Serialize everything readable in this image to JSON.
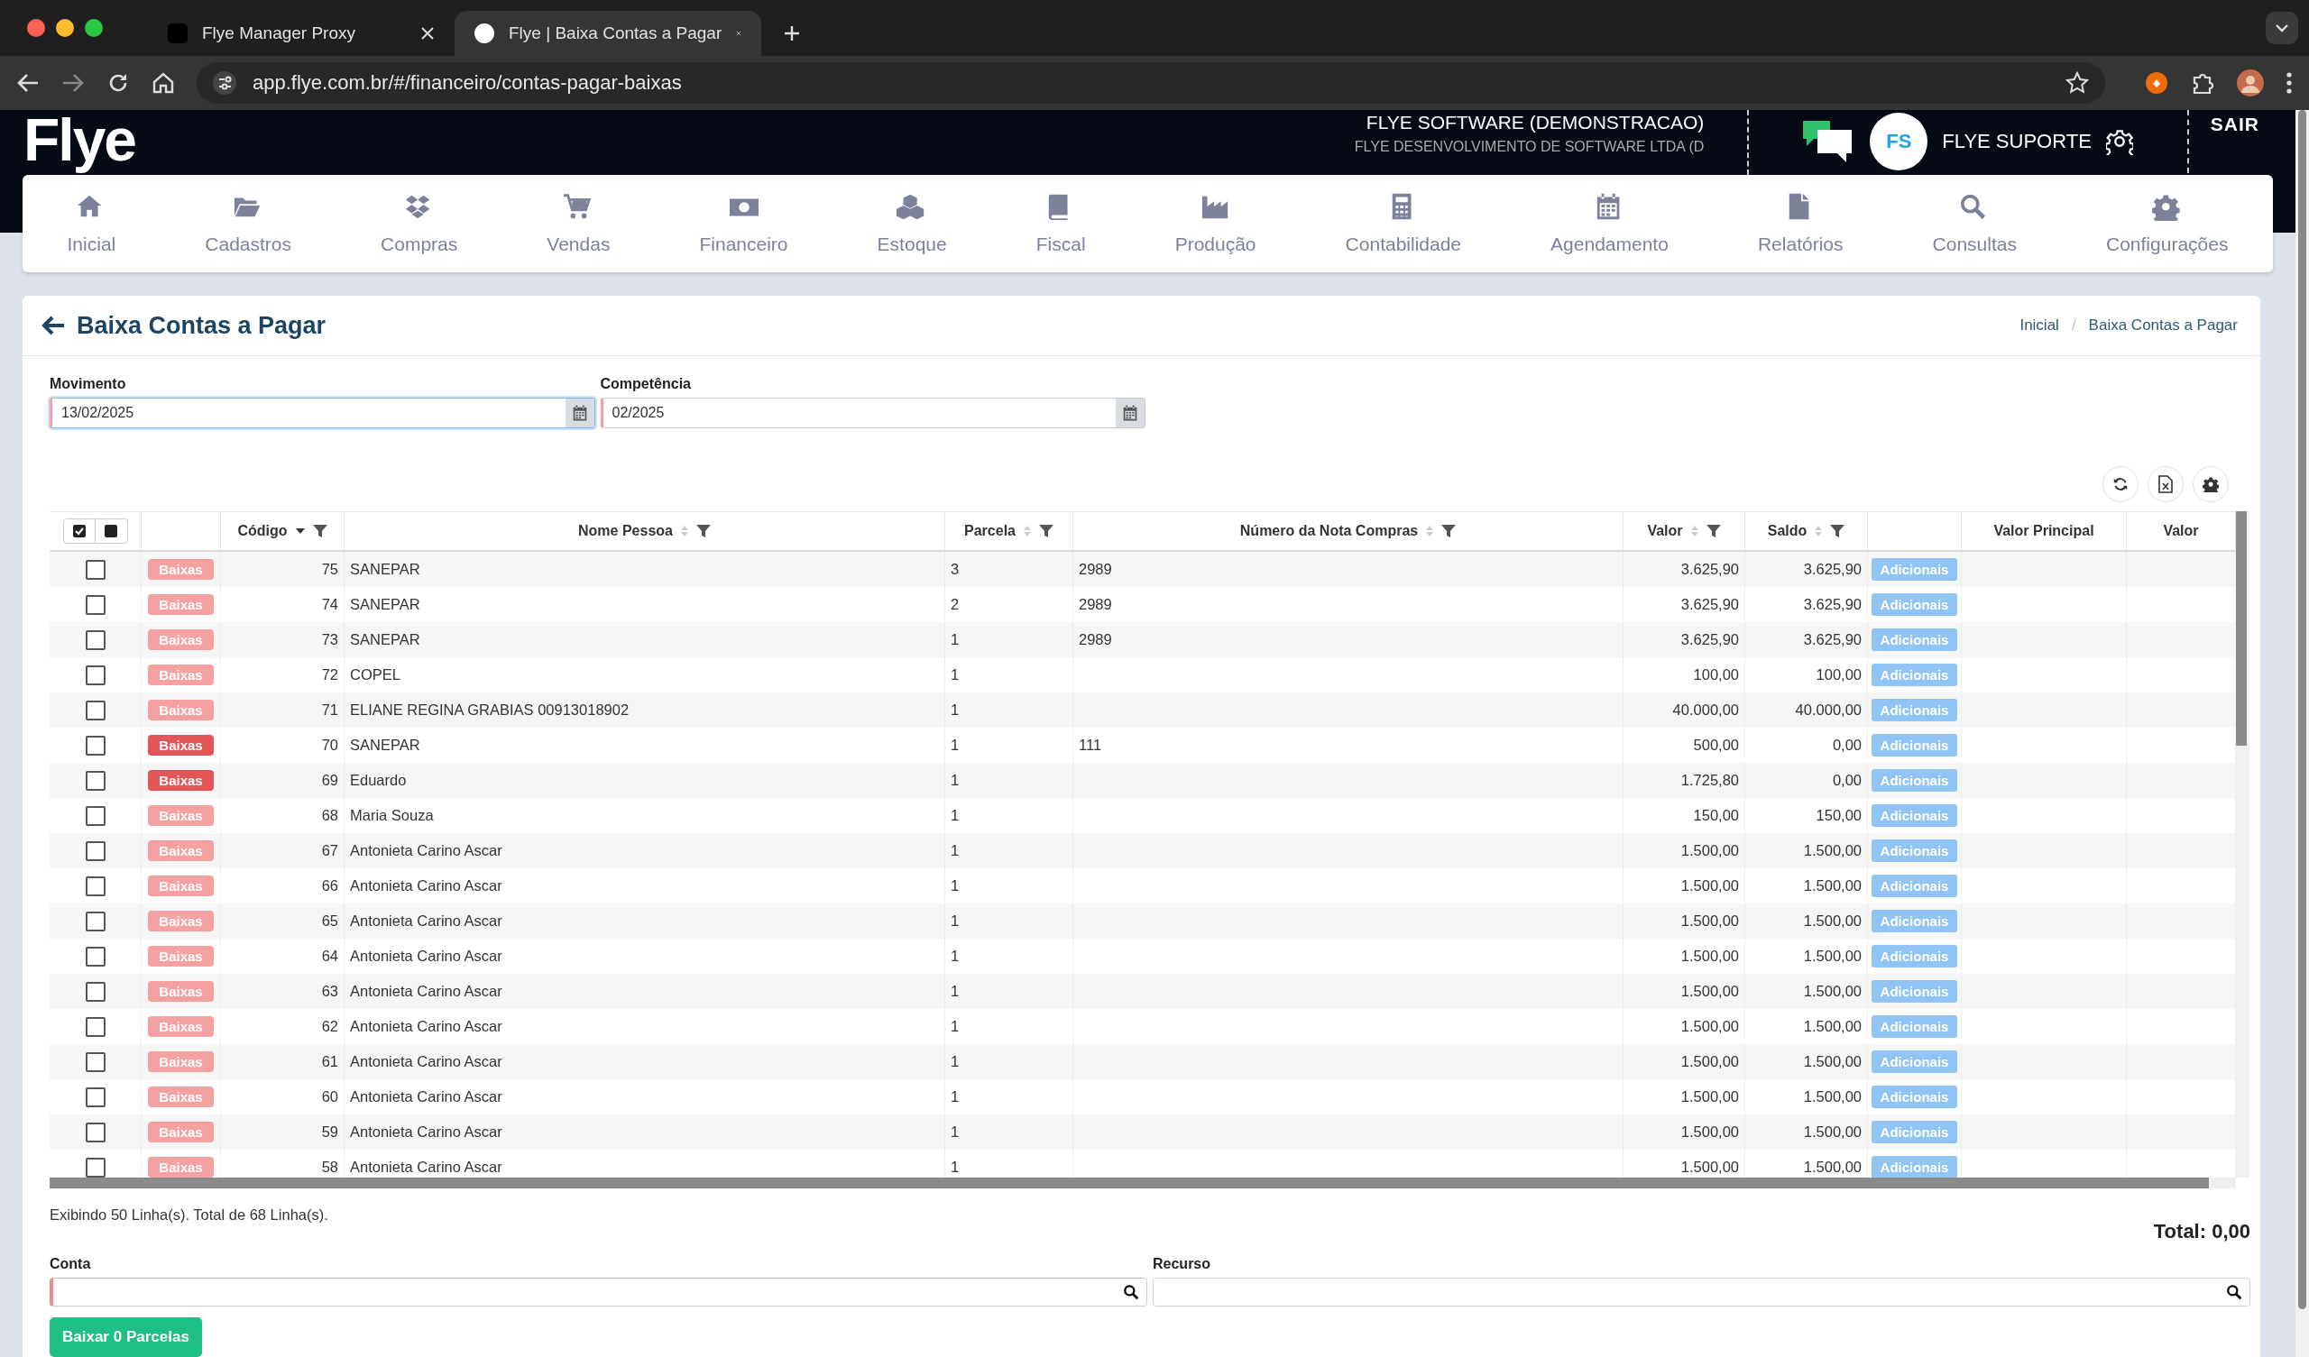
{
  "browser": {
    "tabs": [
      {
        "title": "Flye Manager Proxy",
        "selected": false
      },
      {
        "title": "Flye | Baixa Contas a Pagar",
        "selected": true
      }
    ],
    "url": "app.flye.com.br/#/financeiro/contas-pagar-baixas"
  },
  "header": {
    "logo": "Flye",
    "company": "FLYE SOFTWARE (DEMONSTRACAO)",
    "company_legal": "FLYE DESENVOLVIMENTO DE SOFTWARE LTDA (D",
    "user_initials": "FS",
    "user_name": "FLYE SUPORTE",
    "logout": "SAIR"
  },
  "nav": [
    {
      "label": "Inicial"
    },
    {
      "label": "Cadastros"
    },
    {
      "label": "Compras"
    },
    {
      "label": "Vendas"
    },
    {
      "label": "Financeiro"
    },
    {
      "label": "Estoque"
    },
    {
      "label": "Fiscal"
    },
    {
      "label": "Produção"
    },
    {
      "label": "Contabilidade"
    },
    {
      "label": "Agendamento"
    },
    {
      "label": "Relatórios"
    },
    {
      "label": "Consultas"
    },
    {
      "label": "Configurações"
    }
  ],
  "page": {
    "title": "Baixa Contas a Pagar",
    "breadcrumb": [
      {
        "label": "Inicial"
      },
      {
        "separator": "/",
        "label": "Baixa Contas a Pagar"
      }
    ]
  },
  "filters": [
    {
      "label": "Movimento",
      "value": "13/02/2025",
      "focused": true
    },
    {
      "label": "Competência",
      "value": "02/2025",
      "focused": false
    }
  ],
  "table": {
    "columns": [
      {
        "kind": "select"
      },
      {
        "kind": "action"
      },
      {
        "kind": "number",
        "label": "Código",
        "sorted": true,
        "filter": true
      },
      {
        "kind": "text",
        "label": "Nome Pessoa",
        "sorted": false,
        "filter": true
      },
      {
        "kind": "text",
        "label": "Parcela",
        "sorted": false,
        "filter": true
      },
      {
        "kind": "text",
        "label": "Número da Nota Compras",
        "sorted": false,
        "filter": true
      },
      {
        "kind": "number",
        "label": "Valor",
        "sorted": false,
        "filter": true
      },
      {
        "kind": "number",
        "label": "Saldo",
        "sorted": false,
        "filter": true
      },
      {
        "kind": "extra"
      },
      {
        "kind": "number",
        "label": "Valor Principal"
      },
      {
        "kind": "number",
        "label": "Valor"
      }
    ],
    "rows": [
      {
        "checked": false,
        "action": "Baixas",
        "action_active": false,
        "codigo": "75",
        "nome": "SANEPAR",
        "parcela": "3",
        "nota": "2989",
        "valor": "3.625,90",
        "saldo": "3.625,90",
        "extra": "Adicionais"
      },
      {
        "checked": false,
        "action": "Baixas",
        "action_active": false,
        "codigo": "74",
        "nome": "SANEPAR",
        "parcela": "2",
        "nota": "2989",
        "valor": "3.625,90",
        "saldo": "3.625,90",
        "extra": "Adicionais"
      },
      {
        "checked": false,
        "action": "Baixas",
        "action_active": false,
        "codigo": "73",
        "nome": "SANEPAR",
        "parcela": "1",
        "nota": "2989",
        "valor": "3.625,90",
        "saldo": "3.625,90",
        "extra": "Adicionais"
      },
      {
        "checked": false,
        "action": "Baixas",
        "action_active": false,
        "codigo": "72",
        "nome": "COPEL",
        "parcela": "1",
        "valor": "100,00",
        "saldo": "100,00",
        "extra": "Adicionais"
      },
      {
        "checked": false,
        "action": "Baixas",
        "action_active": false,
        "codigo": "71",
        "nome": "ELIANE REGINA GRABIAS 00913018902",
        "parcela": "1",
        "valor": "40.000,00",
        "saldo": "40.000,00",
        "extra": "Adicionais"
      },
      {
        "checked": false,
        "action": "Baixas",
        "action_active": true,
        "codigo": "70",
        "nome": "SANEPAR",
        "parcela": "1",
        "nota": "111",
        "valor": "500,00",
        "saldo": "0,00",
        "extra": "Adicionais"
      },
      {
        "checked": false,
        "action": "Baixas",
        "action_active": true,
        "codigo": "69",
        "nome": "Eduardo",
        "parcela": "1",
        "valor": "1.725,80",
        "saldo": "0,00",
        "extra": "Adicionais"
      },
      {
        "checked": false,
        "action": "Baixas",
        "action_active": false,
        "codigo": "68",
        "nome": "Maria Souza",
        "parcela": "1",
        "valor": "150,00",
        "saldo": "150,00",
        "extra": "Adicionais"
      },
      {
        "checked": false,
        "action": "Baixas",
        "action_active": false,
        "codigo": "67",
        "nome": "Antonieta Carino Ascar",
        "parcela": "1",
        "valor": "1.500,00",
        "saldo": "1.500,00",
        "extra": "Adicionais"
      },
      {
        "checked": false,
        "action": "Baixas",
        "action_active": false,
        "codigo": "66",
        "nome": "Antonieta Carino Ascar",
        "parcela": "1",
        "valor": "1.500,00",
        "saldo": "1.500,00",
        "extra": "Adicionais"
      },
      {
        "checked": false,
        "action": "Baixas",
        "action_active": false,
        "codigo": "65",
        "nome": "Antonieta Carino Ascar",
        "parcela": "1",
        "valor": "1.500,00",
        "saldo": "1.500,00",
        "extra": "Adicionais"
      },
      {
        "checked": false,
        "action": "Baixas",
        "action_active": false,
        "codigo": "64",
        "nome": "Antonieta Carino Ascar",
        "parcela": "1",
        "valor": "1.500,00",
        "saldo": "1.500,00",
        "extra": "Adicionais"
      },
      {
        "checked": false,
        "action": "Baixas",
        "action_active": false,
        "codigo": "63",
        "nome": "Antonieta Carino Ascar",
        "parcela": "1",
        "valor": "1.500,00",
        "saldo": "1.500,00",
        "extra": "Adicionais"
      },
      {
        "checked": false,
        "action": "Baixas",
        "action_active": false,
        "codigo": "62",
        "nome": "Antonieta Carino Ascar",
        "parcela": "1",
        "valor": "1.500,00",
        "saldo": "1.500,00",
        "extra": "Adicionais"
      },
      {
        "checked": false,
        "action": "Baixas",
        "action_active": false,
        "codigo": "61",
        "nome": "Antonieta Carino Ascar",
        "parcela": "1",
        "valor": "1.500,00",
        "saldo": "1.500,00",
        "extra": "Adicionais"
      },
      {
        "checked": false,
        "action": "Baixas",
        "action_active": false,
        "codigo": "60",
        "nome": "Antonieta Carino Ascar",
        "parcela": "1",
        "valor": "1.500,00",
        "saldo": "1.500,00",
        "extra": "Adicionais"
      },
      {
        "checked": false,
        "action": "Baixas",
        "action_active": false,
        "codigo": "59",
        "nome": "Antonieta Carino Ascar",
        "parcela": "1",
        "valor": "1.500,00",
        "saldo": "1.500,00",
        "extra": "Adicionais"
      },
      {
        "checked": false,
        "action": "Baixas",
        "action_active": false,
        "codigo": "58",
        "nome": "Antonieta Carino Ascar",
        "parcela": "1",
        "valor": "1.500,00",
        "saldo": "1.500,00",
        "extra": "Adicionais"
      }
    ]
  },
  "summary": "Exibindo 50 Linha(s). Total de 68 Linha(s).",
  "total": "Total: 0,00",
  "lookups": [
    {
      "label": "Conta",
      "required": true
    },
    {
      "label": "Recurso",
      "required": false
    }
  ],
  "submit": "Baixar 0 Parcelas"
}
